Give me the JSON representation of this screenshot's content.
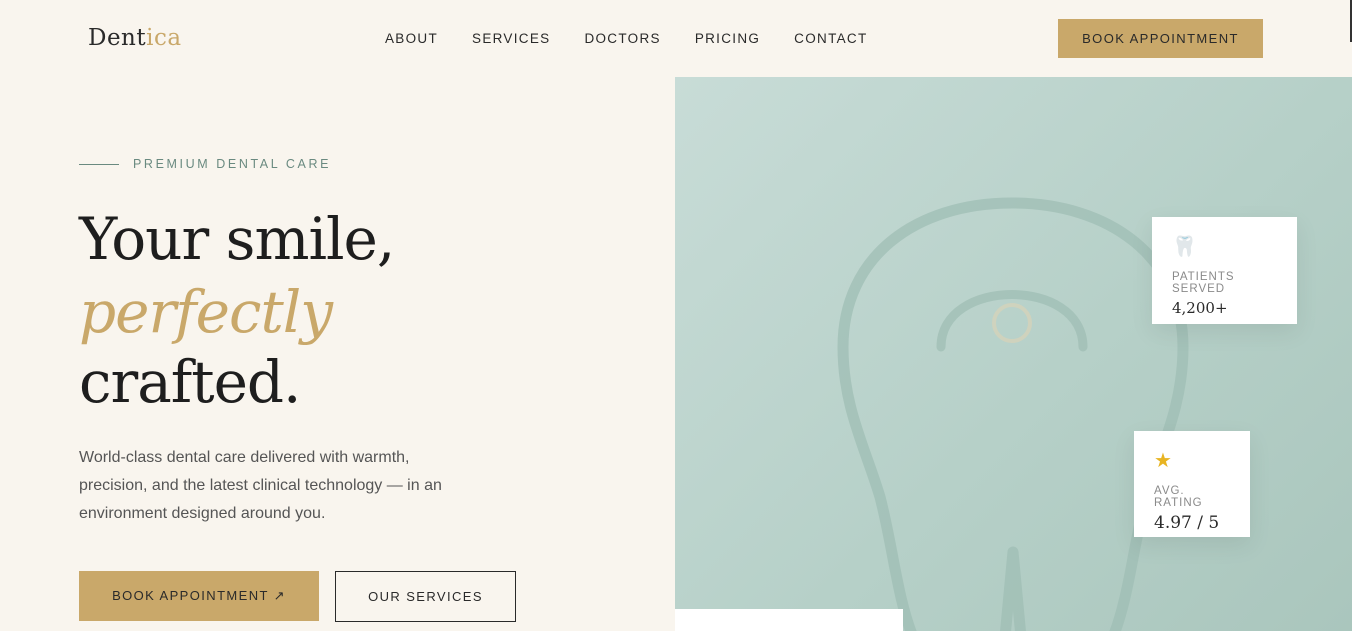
{
  "brand": {
    "logo_main": "Dent",
    "logo_accent": "ica"
  },
  "nav": {
    "items": [
      "ABOUT",
      "SERVICES",
      "DOCTORS",
      "PRICING",
      "CONTACT"
    ],
    "cta_label": "BOOK APPOINTMENT"
  },
  "hero": {
    "eyebrow": "PREMIUM DENTAL CARE",
    "title_line1": "Your smile,",
    "title_line2": "perfectly",
    "title_line3": "crafted.",
    "description": "World-class dental care delivered with warmth, precision, and the latest clinical technology — in an environment designed around you.",
    "primary_button": "BOOK APPOINTMENT ↗",
    "secondary_button": "OUR SERVICES"
  },
  "stats": [
    {
      "icon": "tooth-icon",
      "label": "PATIENTS SERVED",
      "value": "4,200+"
    },
    {
      "icon": "star-icon",
      "label": "AVG. RATING",
      "value": "4.97 / 5"
    }
  ],
  "colors": {
    "accent": "#c9a86a",
    "background": "#f9f5ee",
    "panel": "#b6d0c8",
    "eyebrow": "#6a8a80"
  }
}
